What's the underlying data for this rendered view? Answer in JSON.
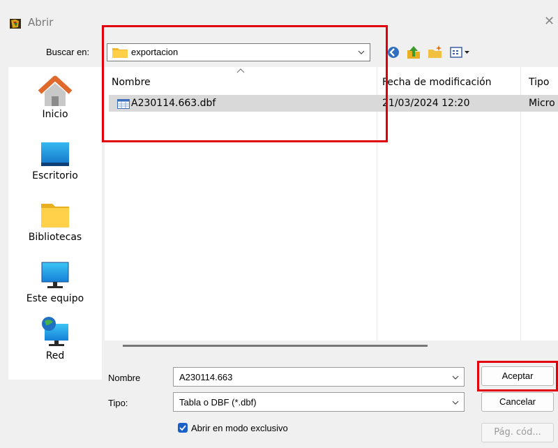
{
  "window": {
    "title": "Abrir",
    "close_glyph": "✕",
    "app_icon": "foxpro-app-icon"
  },
  "toolbar": {
    "look_in_label": "Buscar en:",
    "current_folder": "exportacion",
    "buttons": [
      "back-icon",
      "up-folder-icon",
      "new-folder-icon",
      "view-menu-icon"
    ]
  },
  "places": [
    {
      "label": "Inicio",
      "icon": "home-icon"
    },
    {
      "label": "Escritorio",
      "icon": "desktop-icon"
    },
    {
      "label": "Bibliotecas",
      "icon": "libraries-icon"
    },
    {
      "label": "Este equipo",
      "icon": "computer-icon"
    },
    {
      "label": "Red",
      "icon": "network-icon"
    }
  ],
  "file_list": {
    "columns": [
      "Nombre",
      "Fecha de modificación",
      "Tipo"
    ],
    "rows": [
      {
        "name": "A230114.663.dbf",
        "modified": "21/03/2024 12:20",
        "type": "Micro"
      }
    ]
  },
  "form": {
    "name_label": "Nombre",
    "name_value": "A230114.663",
    "type_label": "Tipo:",
    "type_value": "Tabla o DBF (*.dbf)",
    "exclusive_checkbox_label": "Abrir en modo exclusivo",
    "exclusive_checked": true
  },
  "buttons": {
    "accept": "Aceptar",
    "cancel": "Cancelar",
    "codepage": "Pág. cód..."
  },
  "colors": {
    "highlight_box": "#e1000a",
    "selected_row": "#d9d9d9",
    "checkbox_accent": "#1a60c8"
  }
}
